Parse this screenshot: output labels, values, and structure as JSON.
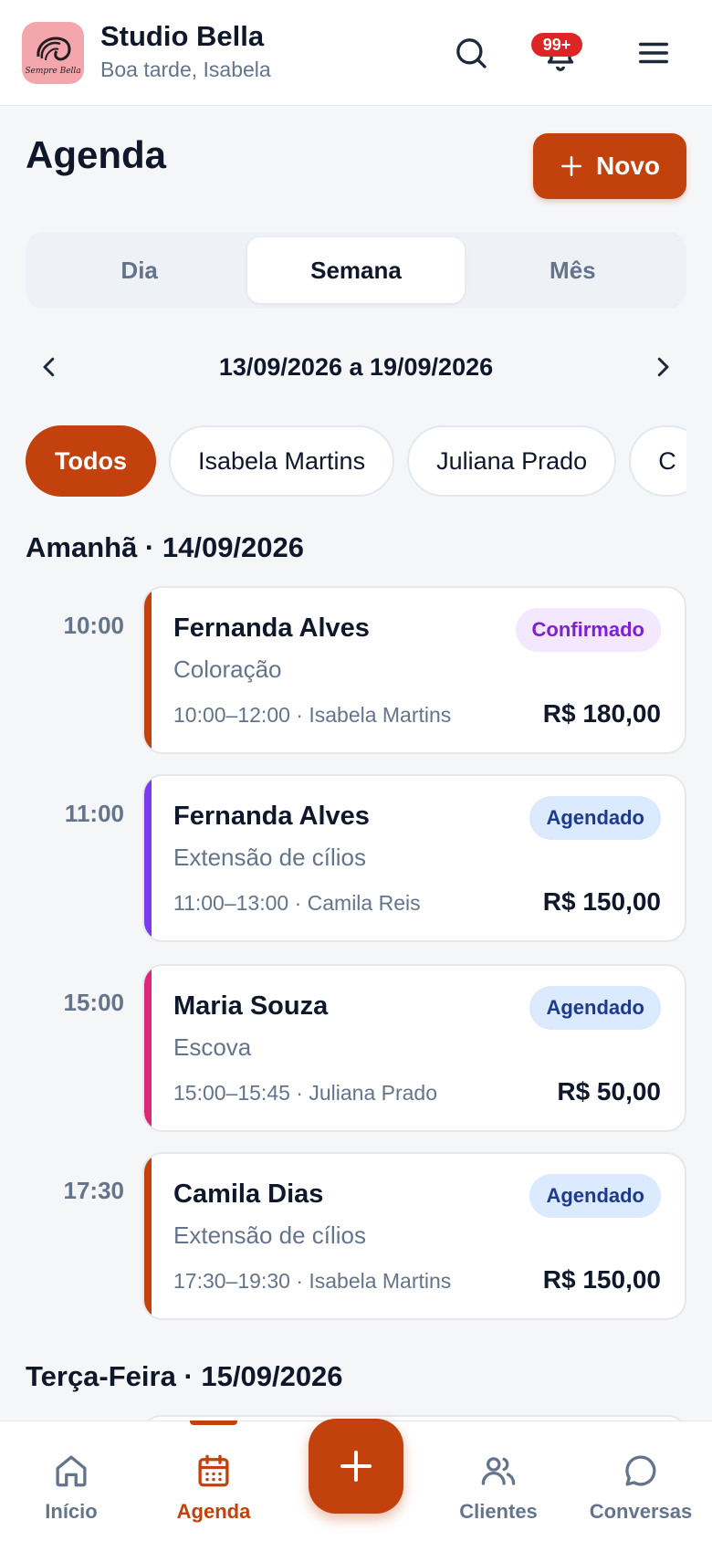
{
  "app": {
    "name": "Studio Bella",
    "greeting": "Boa tarde, Isabela",
    "logo_text": "Sempre Bella",
    "notification_count": "99+",
    "accent": "#c2410c"
  },
  "page": {
    "title": "Agenda",
    "new_button": "Novo"
  },
  "views": {
    "tabs": [
      "Dia",
      "Semana",
      "Mês"
    ],
    "active": "Semana"
  },
  "date_nav": {
    "range": "13/09/2026 a 19/09/2026"
  },
  "filters": {
    "chips": [
      "Todos",
      "Isabela Martins",
      "Juliana Prado",
      "C"
    ],
    "active": "Todos"
  },
  "days": [
    {
      "header": "Amanhã · 14/09/2026",
      "appointments": [
        {
          "time": "10:00",
          "client": "Fernanda Alves",
          "service": "Coloração",
          "meta": "10:00–12:00 · Isabela Martins",
          "price": "R$ 180,00",
          "status": "Confirmado",
          "status_bg": "#f3e8ff",
          "status_fg": "#7e22ce",
          "color": "#c2410c"
        },
        {
          "time": "11:00",
          "client": "Fernanda Alves",
          "service": "Extensão de cílios",
          "meta": "11:00–13:00 · Camila Reis",
          "price": "R$ 150,00",
          "status": "Agendado",
          "status_bg": "#dbeafe",
          "status_fg": "#1e3a8a",
          "color": "#7c3aed"
        },
        {
          "time": "15:00",
          "client": "Maria Souza",
          "service": "Escova",
          "meta": "15:00–15:45 · Juliana Prado",
          "price": "R$ 50,00",
          "status": "Agendado",
          "status_bg": "#dbeafe",
          "status_fg": "#1e3a8a",
          "color": "#db2777"
        },
        {
          "time": "17:30",
          "client": "Camila Dias",
          "service": "Extensão de cílios",
          "meta": "17:30–19:30 · Isabela Martins",
          "price": "R$ 150,00",
          "status": "Agendado",
          "status_bg": "#dbeafe",
          "status_fg": "#1e3a8a",
          "color": "#c2410c"
        }
      ]
    },
    {
      "header": "Terça-Feira · 15/09/2026",
      "appointments": []
    }
  ],
  "bottom_nav": {
    "items": [
      {
        "label": "Início",
        "icon": "home-icon"
      },
      {
        "label": "Agenda",
        "icon": "calendar-icon"
      },
      {
        "label": "Clientes",
        "icon": "users-icon"
      },
      {
        "label": "Conversas",
        "icon": "chat-icon"
      }
    ],
    "active": "Agenda"
  }
}
